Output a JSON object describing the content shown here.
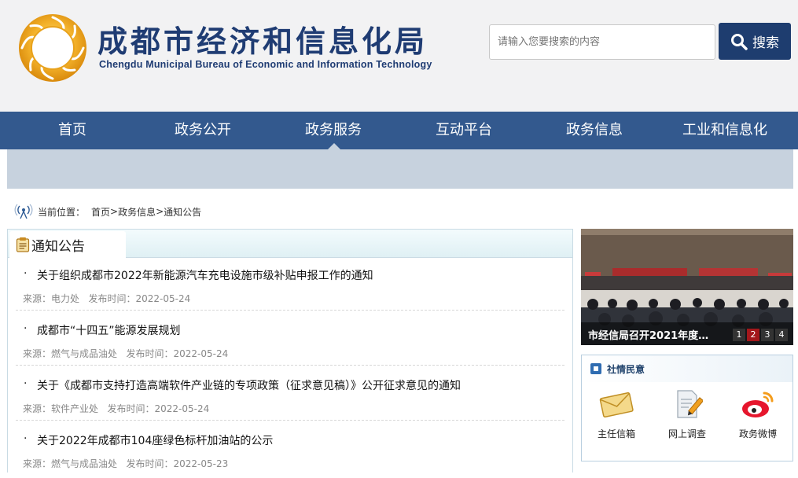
{
  "header": {
    "title": "成都市经济和信息化局",
    "subtitle": "Chengdu Municipal Bureau of Economic and Information Technology",
    "search_placeholder": "请输入您要搜索的内容",
    "search_label": "搜索"
  },
  "nav": {
    "items": [
      "首页",
      "政务公开",
      "政务服务",
      "互动平台",
      "政务信息",
      "工业和信息化"
    ],
    "active": "政务服务"
  },
  "breadcrumb": {
    "prefix": "当前位置：",
    "items": [
      "首页",
      "政务信息",
      "通知公告"
    ],
    "separator": ">"
  },
  "notice": {
    "title": "通知公告",
    "items": [
      {
        "title": "关于组织成都市2022年新能源汽车充电设施市级补贴申报工作的通知",
        "source_label": "来源：",
        "source": "电力处",
        "date_label": "发布时间：",
        "date": "2022-05-24"
      },
      {
        "title": "成都市“十四五”能源发展规划",
        "source_label": "来源：",
        "source": "燃气与成品油处",
        "date_label": "发布时间：",
        "date": "2022-05-24"
      },
      {
        "title": "关于《成都市支持打造高端软件产业链的专项政策（征求意见稿）》公开征求意见的通知",
        "source_label": "来源：",
        "source": "软件产业处",
        "date_label": "发布时间：",
        "date": "2022-05-24"
      },
      {
        "title": "关于2022年成都市104座绿色标杆加油站的公示",
        "source_label": "来源：",
        "source": "燃气与成品油处",
        "date_label": "发布时间：",
        "date": "2022-05-23"
      }
    ]
  },
  "slideshow": {
    "caption": "市经信局召开2021年度…",
    "pages": [
      "1",
      "2",
      "3",
      "4"
    ],
    "active_page": "2"
  },
  "social": {
    "title": "社情民意",
    "items": [
      {
        "label": "主任信箱",
        "icon": "envelope-icon"
      },
      {
        "label": "网上调查",
        "icon": "survey-pencil-icon"
      },
      {
        "label": "政务微博",
        "icon": "weibo-icon"
      }
    ]
  },
  "colors": {
    "nav_bg": "#33598e",
    "title_blue": "#1f3c73",
    "search_btn": "#1e3d6f",
    "banner": "#c7d2de",
    "slide_active": "#a3171b"
  }
}
